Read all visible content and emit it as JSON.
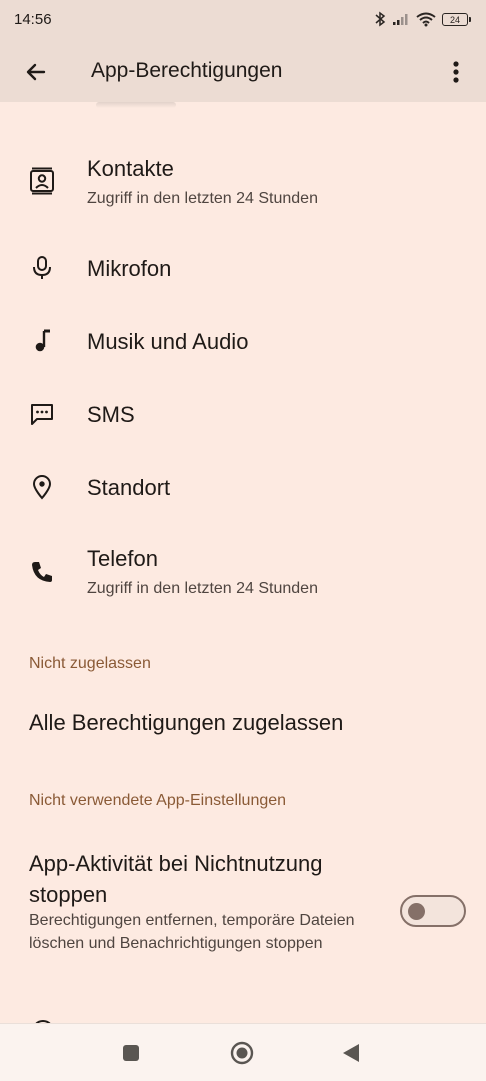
{
  "status_bar": {
    "time": "14:56",
    "battery": "24"
  },
  "app_bar": {
    "title": "App-Berechtigungen"
  },
  "permissions": [
    {
      "label": "Kontakte",
      "sub": "Zugriff in den letzten 24 Stunden",
      "icon": "contacts-icon"
    },
    {
      "label": "Mikrofon",
      "icon": "microphone-icon"
    },
    {
      "label": "Musik und Audio",
      "icon": "music-note-icon"
    },
    {
      "label": "SMS",
      "icon": "sms-icon"
    },
    {
      "label": "Standort",
      "icon": "location-pin-icon"
    },
    {
      "label": "Telefon",
      "sub": "Zugriff in den letzten 24 Stunden",
      "icon": "phone-icon"
    }
  ],
  "not_allowed": {
    "header": "Nicht zugelassen",
    "item": "Alle Berechtigungen zugelassen"
  },
  "unused": {
    "header": "Nicht verwendete App-Einstellungen",
    "title": "App-Aktivität bei Nichtnutzung stoppen",
    "summary": "Berechtigungen entfernen, temporäre Dateien löschen und Benachrichtigungen stoppen",
    "toggle_on": false
  },
  "colors": {
    "background": "#fdeae1",
    "app_bar": "#ecdcd3",
    "section_header": "#8a5a36"
  }
}
